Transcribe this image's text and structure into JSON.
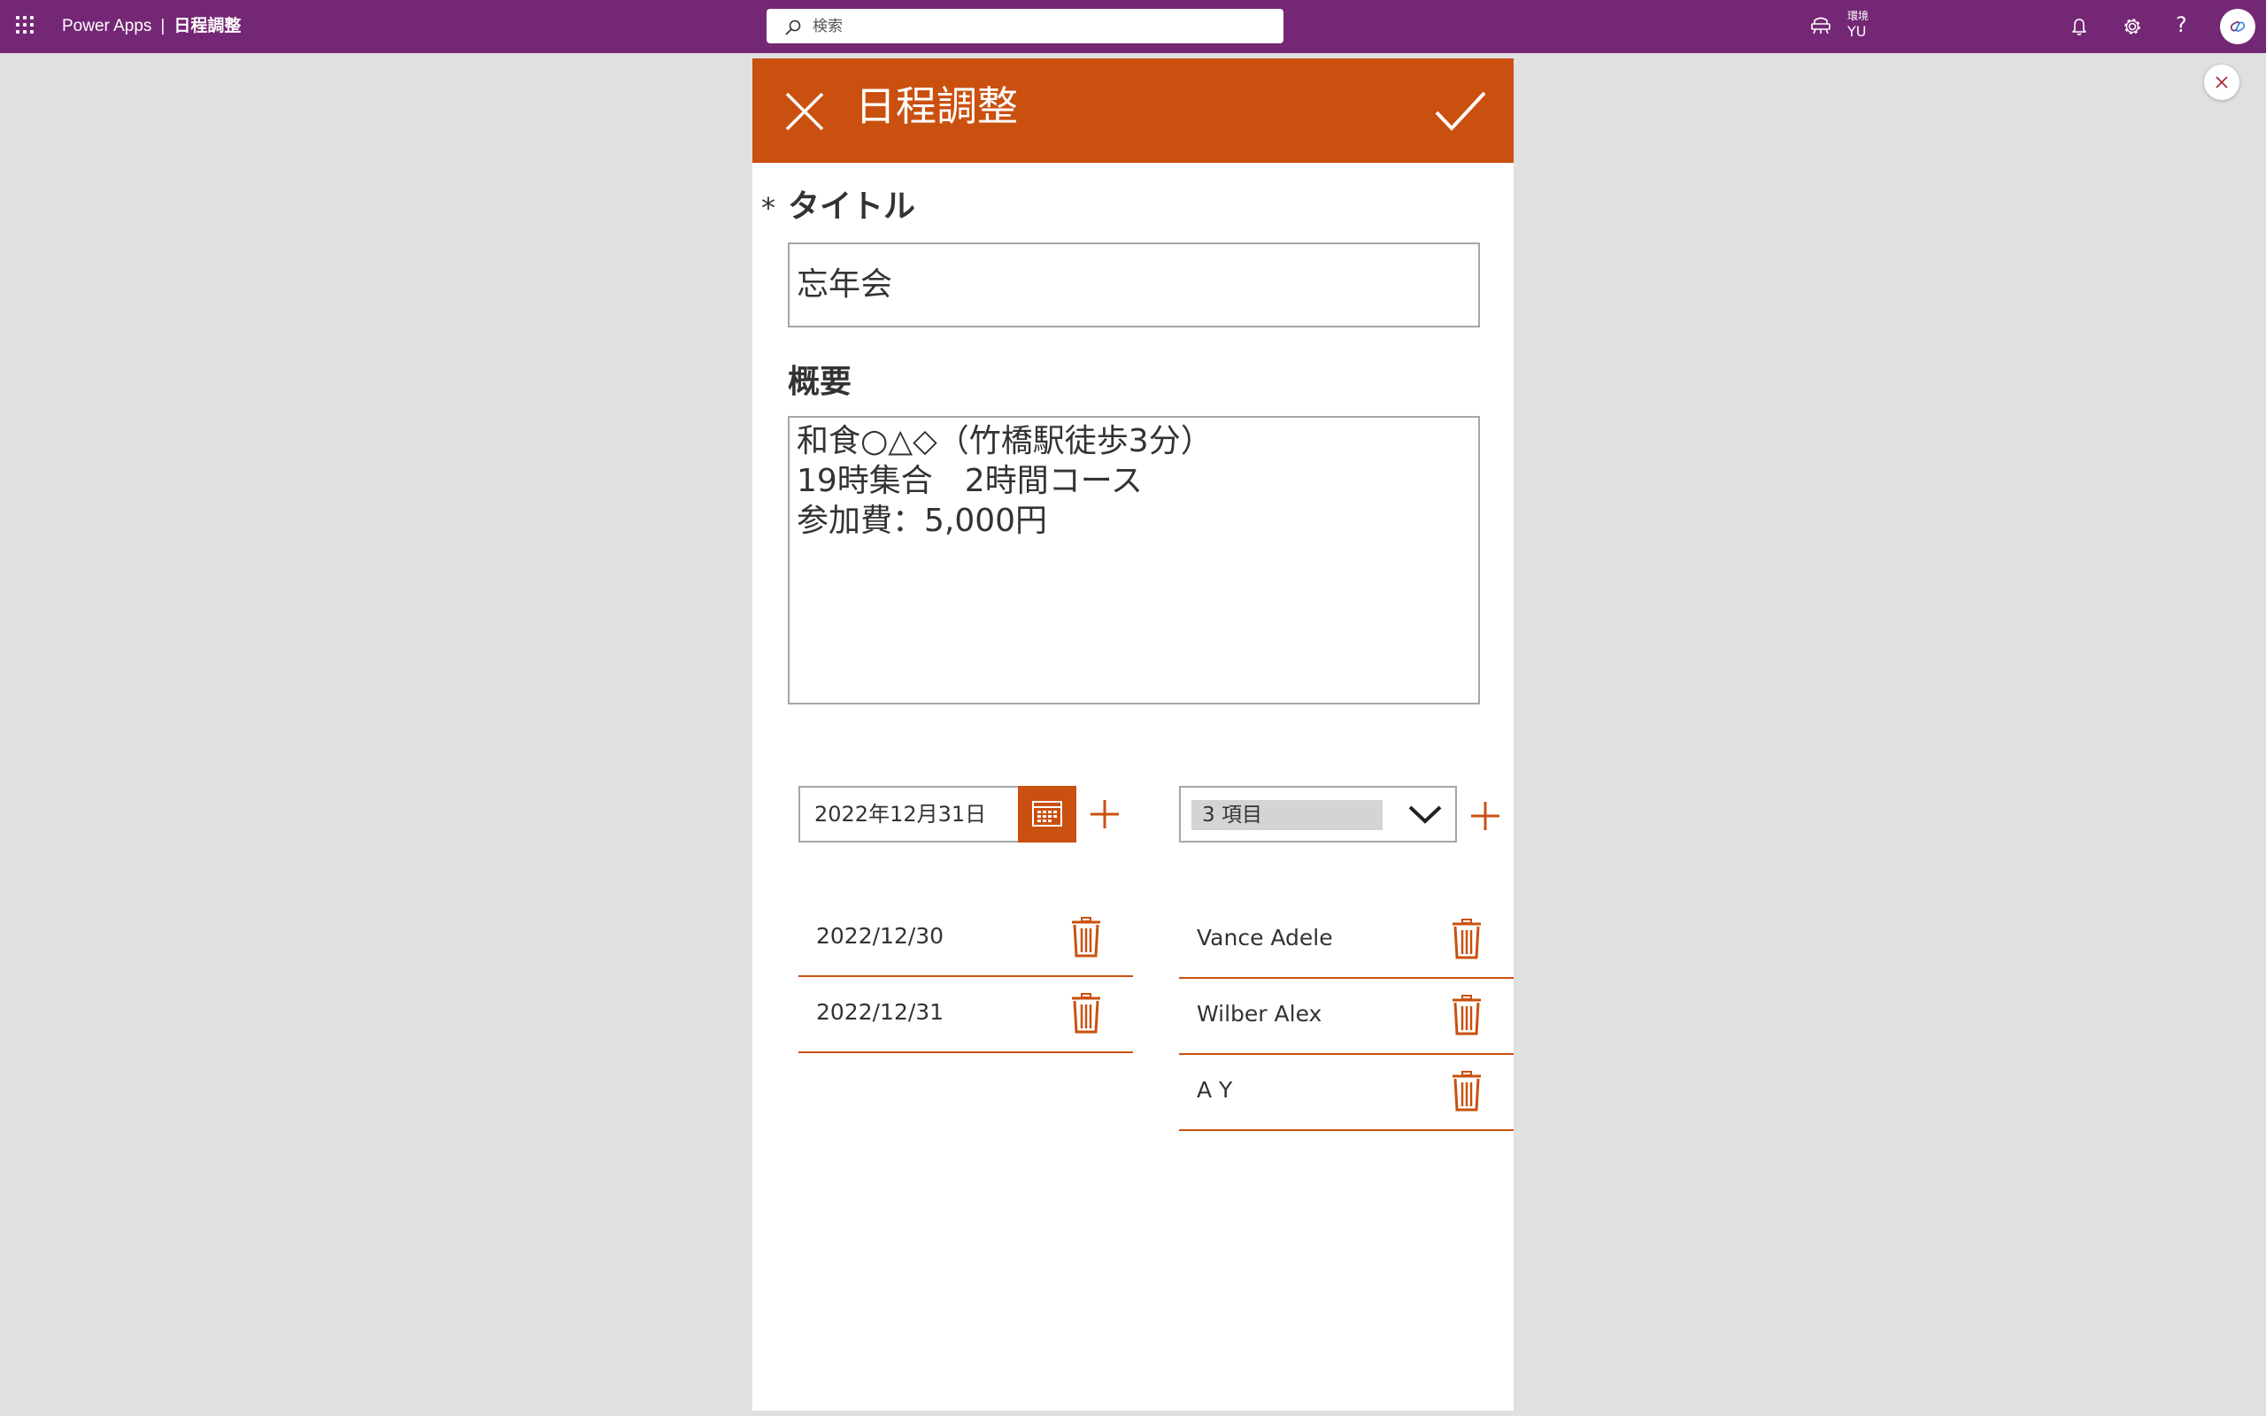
{
  "topbar": {
    "product": "Power Apps",
    "separator": "|",
    "app_name": "日程調整",
    "search_placeholder": "検索",
    "environment_label": "環境",
    "environment_name": "YU",
    "help_glyph": "?",
    "background_color": "#742774"
  },
  "app": {
    "header": {
      "title": "日程調整",
      "color": "#ca5010"
    },
    "form": {
      "required_mark": "*",
      "title_label": "タイトル",
      "title_value": "忘年会",
      "description_label": "概要",
      "description_lines": [
        "和食○△◇（竹橋駅徒歩3分）",
        "19時集合　2時間コース",
        "参加費：5,000円"
      ]
    },
    "dates": {
      "picker_value": "2022年12月31日",
      "items": [
        {
          "label": "2022/12/30"
        },
        {
          "label": "2022/12/31"
        }
      ]
    },
    "participants": {
      "combo_selection": "3 項目",
      "items": [
        {
          "label": "Vance Adele"
        },
        {
          "label": "Wilber Alex"
        },
        {
          "label": "A Y"
        }
      ]
    }
  },
  "icons": {
    "waffle": "waffle-icon",
    "search": "search-icon",
    "environment": "environment-icon",
    "bell": "bell-icon",
    "settings": "gear-icon",
    "avatar": "copilot-avatar-icon",
    "close": "close-icon",
    "check": "check-icon",
    "calendar": "calendar-icon",
    "plus": "plus-icon",
    "trash": "trash-icon",
    "chevron": "chevron-down-icon"
  }
}
